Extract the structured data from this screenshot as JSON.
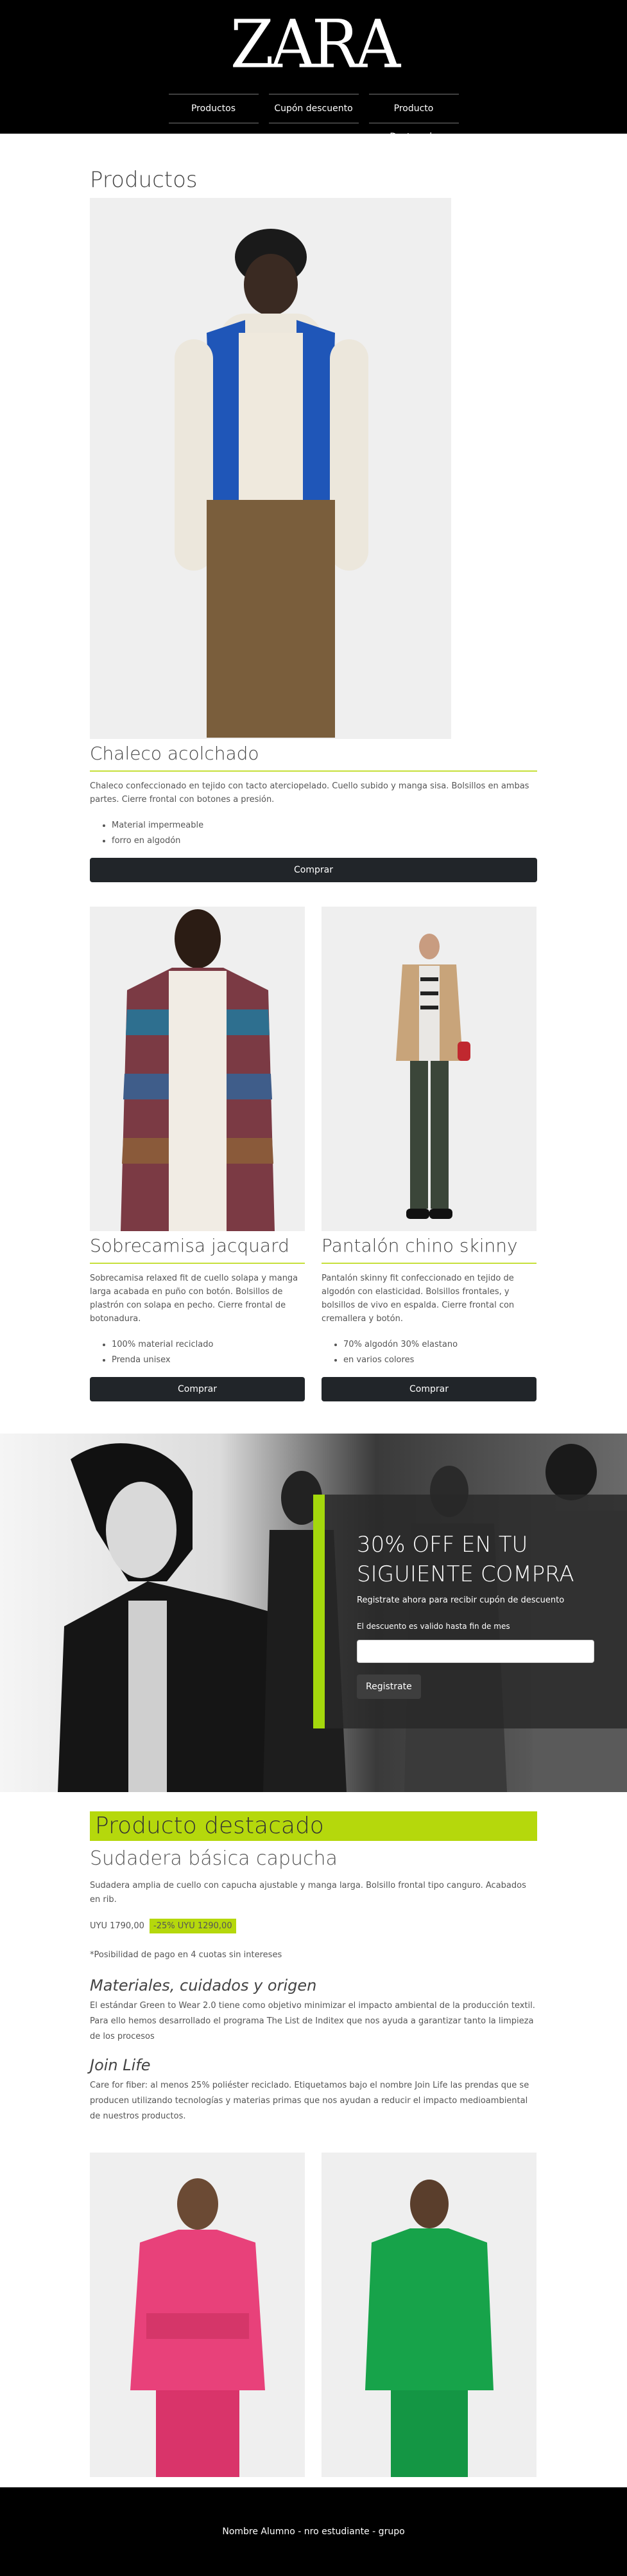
{
  "header": {
    "logo": "ZARA",
    "nav": [
      "Productos",
      "Cupón descuento",
      "Producto Destacado"
    ]
  },
  "products": {
    "title": "Productos",
    "main": {
      "name": "Chaleco acolchado",
      "description": "Chaleco confeccionado en tejido con tacto aterciopelado. Cuello subido y manga sisa. Bolsillos en ambas partes. Cierre frontal con botones a presión.",
      "features": [
        "Material impermeable",
        "forro en algodón"
      ],
      "button": "Comprar"
    },
    "items": [
      {
        "name": "Sobrecamisa jacquard",
        "description": "Sobrecamisa relaxed fit de cuello solapa y manga larga acabada en puño con botón. Bolsillos de plastrón con solapa en pecho. Cierre frontal de botonadura.",
        "features": [
          "100% material reciclado",
          "Prenda unisex"
        ],
        "button": "Comprar"
      },
      {
        "name": "Pantalón chino skinny",
        "description": "Pantalón skinny fit confeccionado en tejido de algodón con elasticidad. Bolsillos frontales, y bolsillos de vivo en espalda. Cierre frontal con cremallera y botón.",
        "features": [
          "70% algodón 30% elastano",
          "en varios colores"
        ],
        "button": "Comprar"
      }
    ]
  },
  "coupon": {
    "title": "30% OFF EN TU SIGUIENTE COMPRA",
    "subtitle": "Registrate ahora para recibir cupón de descuento",
    "note": "El descuento es valido hasta fin de mes",
    "input_placeholder": "",
    "button": "Registrate",
    "accent": "#a4d80c"
  },
  "featured": {
    "header": "Producto destacado",
    "name": "Sudadera básica capucha",
    "description": "Sudadera amplia de cuello con capucha ajustable y manga larga. Bolsillo frontal tipo canguro. Acabados en rib.",
    "price_old": "UYU 1790,00",
    "price_new": "-25% UYU 1290,00",
    "payment_note": "*Posibilidad de pago en 4 cuotas sin intereses",
    "materials_title": "Materiales, cuidados y origen",
    "materials_text": "El estándar Green to Wear 2.0 tiene como objetivo minimizar el impacto ambiental de la producción textil. Para ello hemos desarrollado el programa The List de Inditex que nos ayuda a garantizar tanto la limpieza de los procesos",
    "joinlife_title": "Join Life",
    "joinlife_text": "Care for fiber: al menos 25% poliéster reciclado. Etiquetamos bajo el nombre Join Life las prendas que se producen utilizando tecnologías y materias primas que nos ayudan a reducir el impacto medioambiental de nuestros productos.",
    "accent": "#b5d80c"
  },
  "footer": {
    "text": "Nombre Alumno - nro estudiante - grupo"
  }
}
